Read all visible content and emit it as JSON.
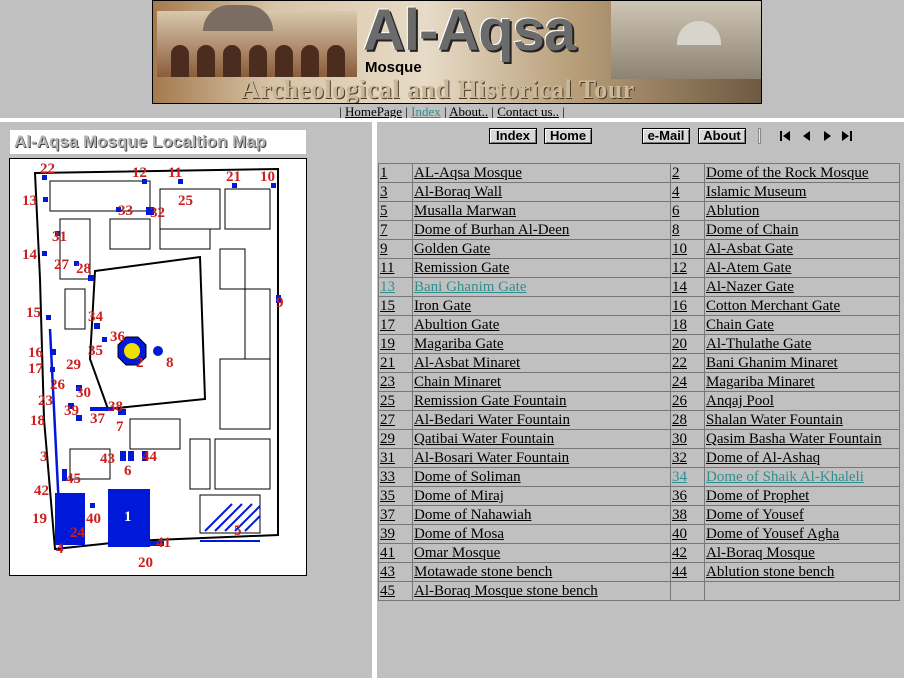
{
  "banner": {
    "title": "Al-Aqsa",
    "subtitle": "Mosque",
    "tagline": "Archeological and Historical Tour"
  },
  "topnav": {
    "open": "|",
    "sep": "|",
    "close": "|",
    "links": [
      "HomePage",
      "Index",
      "About..",
      "Contact us.."
    ],
    "visited": "Index"
  },
  "map": {
    "title": "Al-Aqsa Mosque Localtion Map",
    "labels": [
      "22",
      "12",
      "11",
      "21",
      "10",
      "13",
      "33",
      "32",
      "25",
      "31",
      "14",
      "27",
      "28",
      "9",
      "15",
      "34",
      "36",
      "16",
      "35",
      "2",
      "8",
      "17",
      "29",
      "26",
      "30",
      "23",
      "39",
      "38",
      "18",
      "37",
      "7",
      "3",
      "43",
      "44",
      "6",
      "45",
      "42",
      "40",
      "1",
      "19",
      "24",
      "4",
      "41",
      "5",
      "20"
    ],
    "colors": {
      "marker": "#0018d8",
      "label": "#cc1f1f",
      "outline": "#000000"
    }
  },
  "toolbar": {
    "index": "Index",
    "home": "Home",
    "email": "e-Mail",
    "about": "About",
    "icons": [
      "first-icon",
      "prev-icon",
      "next-icon",
      "last-icon"
    ]
  },
  "sites": [
    {
      "n1": "1",
      "s1": "AL-Aqsa Mosque",
      "n2": "2",
      "s2": "Dome of the Rock Mosque"
    },
    {
      "n1": "3",
      "s1": "Al-Boraq Wall",
      "n2": "4",
      "s2": "Islamic Museum"
    },
    {
      "n1": "5",
      "s1": "Musalla Marwan",
      "n2": "6",
      "s2": "Ablution"
    },
    {
      "n1": "7",
      "s1": "Dome of Burhan Al-Deen",
      "n2": "8",
      "s2": "Dome of Chain"
    },
    {
      "n1": "9",
      "s1": "Golden Gate",
      "n2": "10",
      "s2": "Al-Asbat Gate"
    },
    {
      "n1": "11",
      "s1": "Remission Gate",
      "n2": "12",
      "s2": "Al-Atem Gate"
    },
    {
      "n1": "13",
      "s1": "Bani Ghanim Gate",
      "n2": "14",
      "s2": "Al-Nazer Gate"
    },
    {
      "n1": "15",
      "s1": "Iron Gate",
      "n2": "16",
      "s2": "Cotton Merchant Gate"
    },
    {
      "n1": "17",
      "s1": "Abultion Gate",
      "n2": "18",
      "s2": "Chain Gate"
    },
    {
      "n1": "19",
      "s1": "Magariba Gate",
      "n2": "20",
      "s2": "Al-Thulathe Gate"
    },
    {
      "n1": "21",
      "s1": "Al-Asbat Minaret",
      "n2": "22",
      "s2": "Bani Ghanim Minaret"
    },
    {
      "n1": "23",
      "s1": "Chain Minaret",
      "n2": "24",
      "s2": "Magariba Minaret"
    },
    {
      "n1": "25",
      "s1": "Remission Gate Fountain",
      "n2": "26",
      "s2": "Anqaj Pool"
    },
    {
      "n1": "27",
      "s1": "Al-Bedari Water Fountain",
      "n2": "28",
      "s2": "Shalan Water Fountain"
    },
    {
      "n1": "29",
      "s1": "Qatibai Water Fountain",
      "n2": "30",
      "s2": "Qasim Basha Water Fountain"
    },
    {
      "n1": "31",
      "s1": "Al-Bosari Water Fountain",
      "n2": "32",
      "s2": "Dome of Al-Ashaq"
    },
    {
      "n1": "33",
      "s1": "Dome of Soliman",
      "n2": "34",
      "s2": "Dome of Shaik Al-Khaleli"
    },
    {
      "n1": "35",
      "s1": "Dome of Miraj",
      "n2": "36",
      "s2": "Dome of Prophet"
    },
    {
      "n1": "37",
      "s1": "Dome of Nahawiah",
      "n2": "38",
      "s2": "Dome of Yousef"
    },
    {
      "n1": "39",
      "s1": "Dome of Mosa",
      "n2": "40",
      "s2": "Dome of Yousef Agha"
    },
    {
      "n1": "41",
      "s1": "Omar Mosque",
      "n2": "42",
      "s2": "Al-Boraq Mosque"
    },
    {
      "n1": "43",
      "s1": "Motawade stone bench",
      "n2": "44",
      "s2": "Ablution stone bench"
    },
    {
      "n1": "45",
      "s1": "Al-Boraq Mosque stone bench",
      "n2": "",
      "s2": ""
    }
  ],
  "visited_links": [
    "13",
    "34"
  ],
  "colors": {
    "background": "#c0c0c0",
    "visited_link": "#2f8f8f",
    "divider": "#ffffff"
  }
}
